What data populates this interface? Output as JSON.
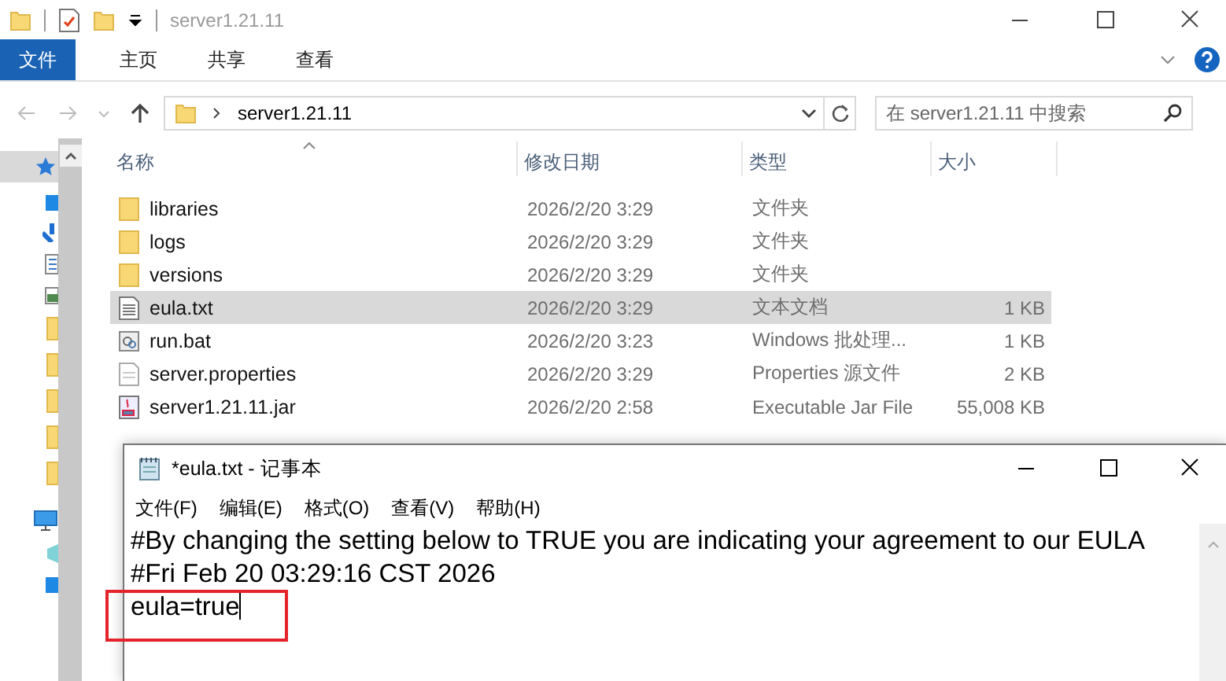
{
  "window": {
    "title": "server1.21.11"
  },
  "ribbon_tabs": [
    {
      "label": "文件",
      "selected": true
    },
    {
      "label": "主页",
      "selected": false
    },
    {
      "label": "共享",
      "selected": false
    },
    {
      "label": "查看",
      "selected": false
    }
  ],
  "address": {
    "path": "server1.21.11"
  },
  "search": {
    "placeholder": "在 server1.21.11 中搜索"
  },
  "table": {
    "columns": [
      "名称",
      "修改日期",
      "类型",
      "大小"
    ],
    "rows": [
      {
        "kind": "folder",
        "name": "libraries",
        "date": "2026/2/20 3:29",
        "type": "文件夹",
        "size": "",
        "selected": false
      },
      {
        "kind": "folder",
        "name": "logs",
        "date": "2026/2/20 3:29",
        "type": "文件夹",
        "size": "",
        "selected": false
      },
      {
        "kind": "folder",
        "name": "versions",
        "date": "2026/2/20 3:29",
        "type": "文件夹",
        "size": "",
        "selected": false
      },
      {
        "kind": "text",
        "name": "eula.txt",
        "date": "2026/2/20 3:29",
        "type": "文本文档",
        "size": "1 KB",
        "selected": true
      },
      {
        "kind": "batch",
        "name": "run.bat",
        "date": "2026/2/20 3:23",
        "type": "Windows 批处理...",
        "size": "1 KB",
        "selected": false
      },
      {
        "kind": "plain",
        "name": "server.properties",
        "date": "2026/2/20 3:29",
        "type": "Properties 源文件",
        "size": "2 KB",
        "selected": false
      },
      {
        "kind": "jar",
        "name": "server1.21.11.jar",
        "date": "2026/2/20 2:58",
        "type": "Executable Jar File",
        "size": "55,008 KB",
        "selected": false
      }
    ]
  },
  "notepad": {
    "title": "*eula.txt - 记事本",
    "menu": [
      "文件(F)",
      "编辑(E)",
      "格式(O)",
      "查看(V)",
      "帮助(H)"
    ],
    "lines": [
      "#By changing the setting below to TRUE you are indicating your agreement to our EULA",
      "#Fri Feb 20 03:29:16 CST 2026",
      "eula=true"
    ]
  }
}
